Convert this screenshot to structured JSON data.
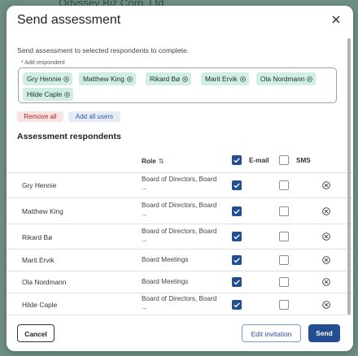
{
  "background": {
    "text": "Odyssey Biz Corp. Ltd"
  },
  "dialog": {
    "title": "Send assessment",
    "description": "Send assessment to selected respondents to complete.",
    "add_respondent_required": "*",
    "add_respondent_label": " Add respondent",
    "chips": [
      "Gry Hennie",
      "Matthew King",
      "Rikard Bø",
      "Marit Ervik",
      "Ola Nordmann",
      "Hilde Caple"
    ],
    "remove_all_label": "Remove all",
    "add_all_label": "Add all users",
    "section_title": "Assessment respondents",
    "table": {
      "headers": {
        "role": "Role",
        "role_sort_glyph": "⇅",
        "email": "E-mail",
        "sms": "SMS"
      },
      "rows": [
        {
          "name": "Gry Hennie",
          "role_line1": "Board of Directors, Board",
          "role_line2": "...",
          "email": true,
          "sms": false
        },
        {
          "name": "Matthew King",
          "role_line1": "Board of Directors, Board",
          "role_line2": "...",
          "email": true,
          "sms": false
        },
        {
          "name": "Rikard Bø",
          "role_line1": "Board of Directors, Board",
          "role_line2": "...",
          "email": true,
          "sms": false
        },
        {
          "name": "Marit Ervik",
          "role_line1": "Board Meetings",
          "role_line2": "",
          "email": true,
          "sms": false
        },
        {
          "name": "Ola Nordmann",
          "role_line1": "Board Meetings",
          "role_line2": "",
          "email": true,
          "sms": false
        },
        {
          "name": "Hilde Caple",
          "role_line1": "Board of Directors, Board",
          "role_line2": "...",
          "email": true,
          "sms": false
        }
      ]
    },
    "footer": {
      "cancel_label": "Cancel",
      "edit_invitation_label": "Edit invitation",
      "send_label": "Send"
    }
  },
  "colors": {
    "primary": "#234e91",
    "chip_bg": "#cfeee4",
    "remove_bg": "#fde2e2",
    "remove_text": "#a32a2a"
  }
}
